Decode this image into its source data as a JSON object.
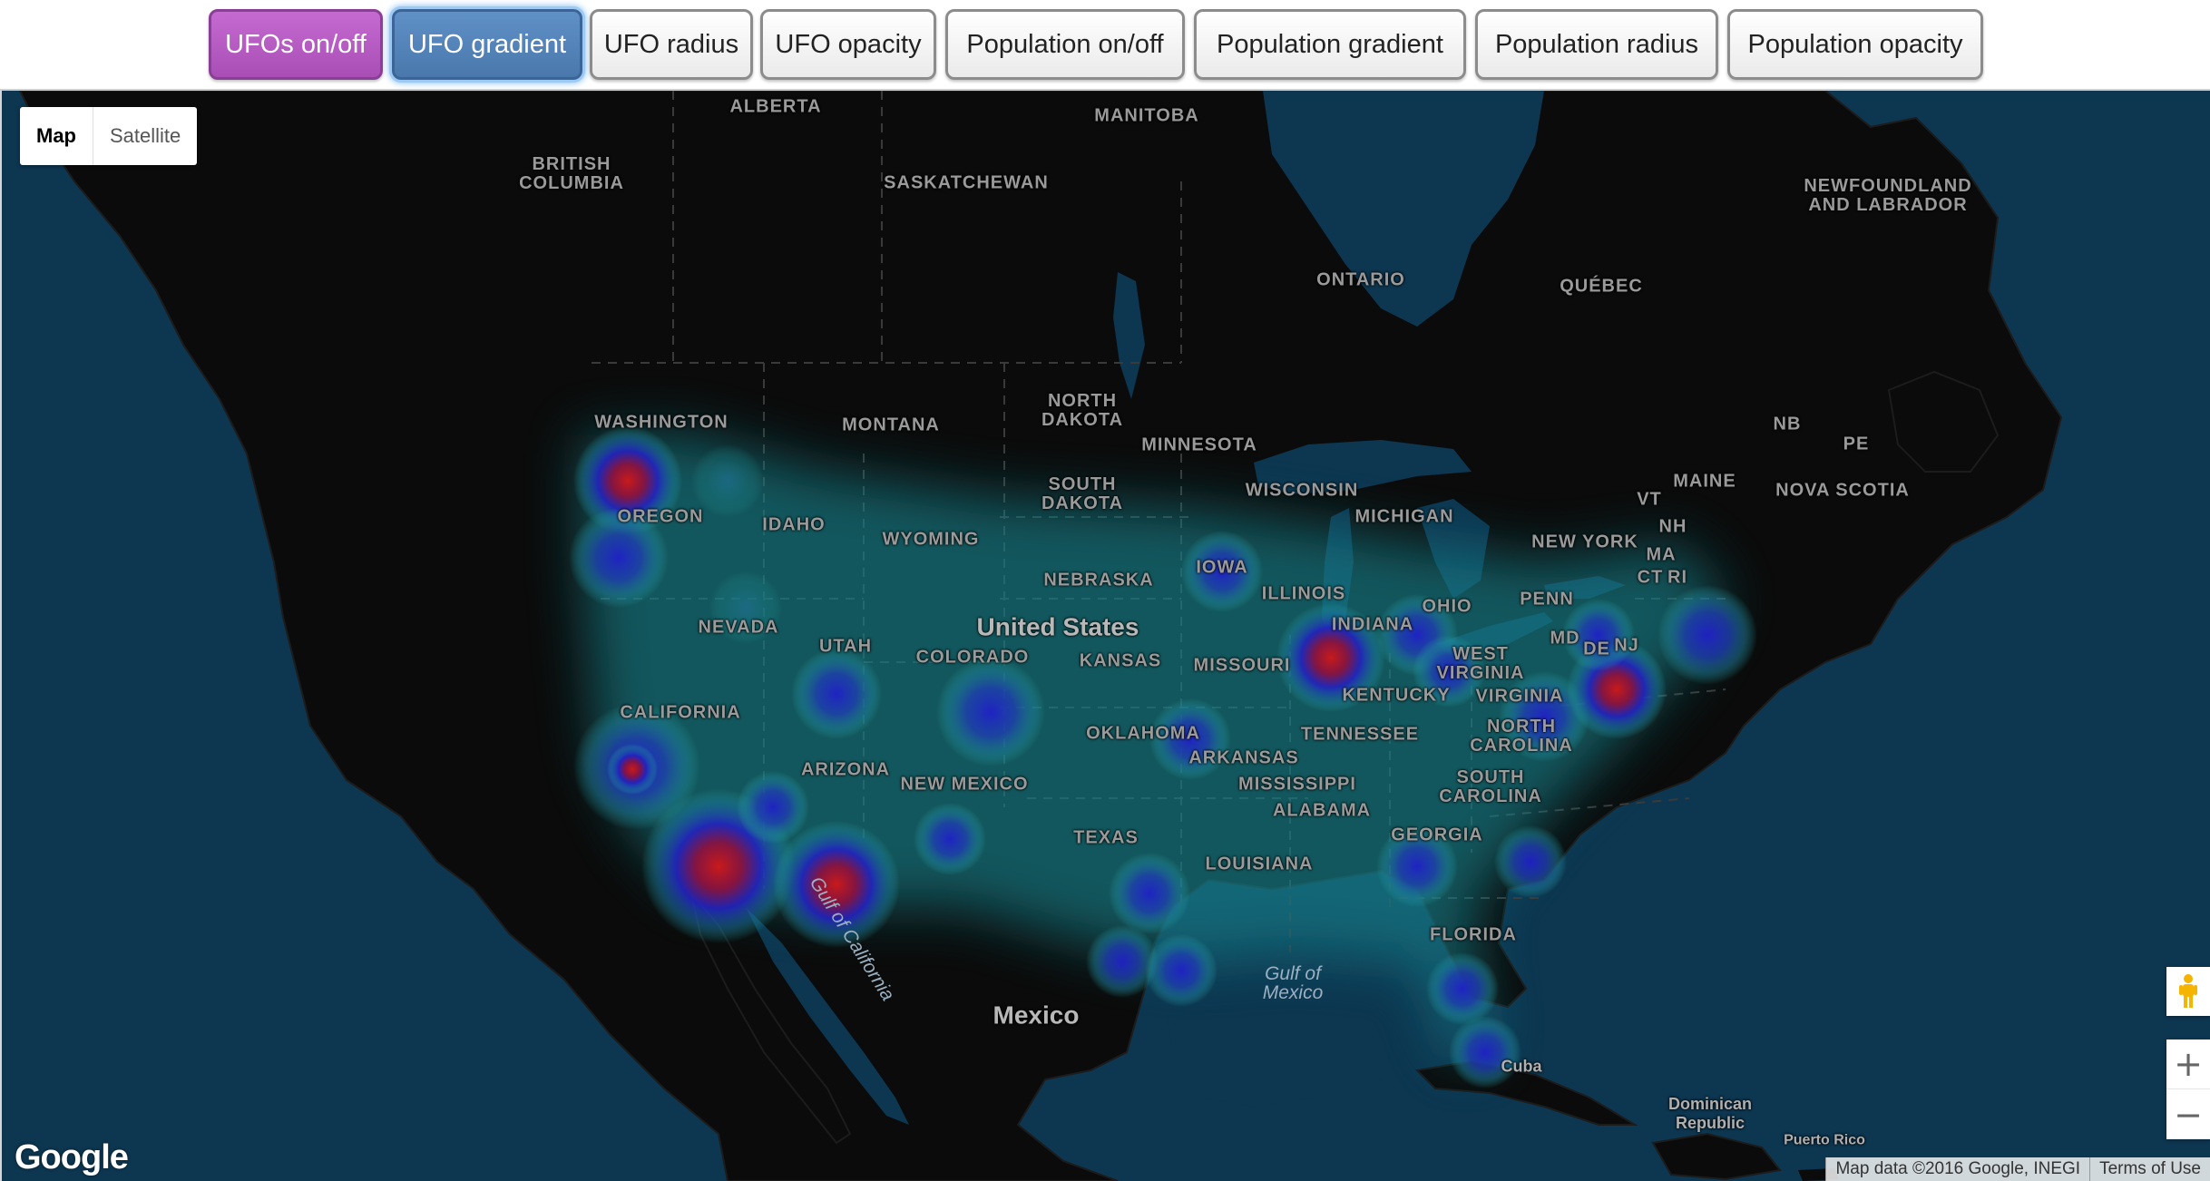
{
  "toolbar": {
    "buttons": [
      {
        "label": "UFOs on/off"
      },
      {
        "label": "UFO gradient"
      },
      {
        "label": "UFO radius"
      },
      {
        "label": "UFO opacity"
      },
      {
        "label": "Population on/off"
      },
      {
        "label": "Population gradient"
      },
      {
        "label": "Population radius"
      },
      {
        "label": "Population opacity"
      }
    ]
  },
  "map_type": {
    "map_label": "Map",
    "satellite_label": "Satellite",
    "selected": "Map"
  },
  "labels": {
    "alberta": "ALBERTA",
    "manitoba": "MANITOBA",
    "british_columbia": "BRITISH\nCOLUMBIA",
    "saskatchewan": "SASKATCHEWAN",
    "newfoundland": "NEWFOUNDLAND\nAND LABRADOR",
    "ontario": "ONTARIO",
    "quebec": "QUÉBEC",
    "nb": "NB",
    "pe": "PE",
    "nova_scotia": "NOVA SCOTIA",
    "washington": "WASHINGTON",
    "montana": "MONTANA",
    "north_dakota": "NORTH\nDAKOTA",
    "minnesota": "MINNESOTA",
    "oregon": "OREGON",
    "idaho": "IDAHO",
    "wyoming": "WYOMING",
    "south_dakota": "SOUTH\nDAKOTA",
    "wisconsin": "WISCONSIN",
    "michigan": "MICHIGAN",
    "maine": "MAINE",
    "vt": "VT",
    "nh": "NH",
    "new_york": "NEW YORK",
    "ma": "MA",
    "ct": "CT",
    "ri": "RI",
    "iowa": "IOWA",
    "nebraska": "NEBRASKA",
    "united_states": "United States",
    "nevada": "NEVADA",
    "utah": "UTAH",
    "illinois": "ILLINOIS",
    "indiana": "INDIANA",
    "ohio": "OHIO",
    "penn": "PENN",
    "md": "MD",
    "de": "DE",
    "nj": "NJ",
    "colorado": "COLORADO",
    "kansas": "KANSAS",
    "missouri": "MISSOURI",
    "west_virginia": "WEST\nVIRGINIA",
    "virginia": "VIRGINIA",
    "kentucky": "KENTUCKY",
    "california": "CALIFORNIA",
    "oklahoma": "OKLAHOMA",
    "tennessee": "TENNESSEE",
    "north_carolina": "NORTH\nCAROLINA",
    "arizona": "ARIZONA",
    "arkansas": "ARKANSAS",
    "new_mexico": "NEW MEXICO",
    "mississippi": "MISSISSIPPI",
    "south_carolina": "SOUTH\nCAROLINA",
    "alabama": "ALABAMA",
    "georgia": "GEORGIA",
    "texas": "TEXAS",
    "louisiana": "LOUISIANA",
    "florida": "FLORIDA",
    "gulf_of_california": "Gulf of California",
    "gulf_of_mexico": "Gulf of\nMexico",
    "mexico": "Mexico",
    "cuba": "Cuba",
    "dominican_republic": "Dominican\nRepublic",
    "puerto_rico": "Puerto Rico"
  },
  "branding": {
    "logo": "Google"
  },
  "attribution": {
    "map_data": "Map data ©2016 Google, INEGI",
    "terms": "Terms of Use"
  },
  "controls": {
    "zoom_in": "+",
    "zoom_out": "−"
  },
  "colors": {
    "water": "#0d3650",
    "land": "#0b0b0b",
    "ufo_toggle_button": "#b65bc3",
    "ufo_gradient_button": "#5584bb",
    "heat_low": "#2bb5b0",
    "heat_mid": "#2020c8",
    "heat_high": "#c01818"
  }
}
